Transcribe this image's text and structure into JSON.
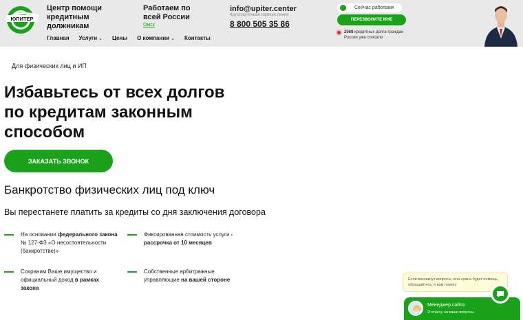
{
  "header": {
    "logo_text": "ЮПИТЕР",
    "brand_lines": [
      "Центр помощи",
      "кредитным",
      "должникам"
    ],
    "worktime_lines": [
      "Работаем по",
      "всей России"
    ],
    "city": "Омск",
    "nav": [
      {
        "label": "Главная",
        "dropdown": false
      },
      {
        "label": "Услуги",
        "dropdown": true
      },
      {
        "label": "Цены",
        "dropdown": false
      },
      {
        "label": "О компании",
        "dropdown": true
      },
      {
        "label": "Контакты",
        "dropdown": false
      }
    ],
    "email": "info@upiter.center",
    "hotline": "Круглосуточная горячая линия",
    "phone": "8 800 505 35 86",
    "status": "Сейчас работаем",
    "callback_btn": "ПЕРЕЗВОНИТЕ МНЕ",
    "debts_count": "2568",
    "debts_text": "кредитных долга граждан России уже списали"
  },
  "hero": {
    "tag": "Для физических лиц и ИП",
    "title_lines": [
      "Избавьтесь от всех долгов",
      "по кредитам законным",
      "способом"
    ],
    "order_btn": "ЗАКАЗАТЬ ЗВОНОК",
    "subtitle": "Банкротство физических лиц под ключ",
    "lead": "Вы перестанете платить за кредиты со дня заключения договора"
  },
  "features": [
    {
      "pre": "На основании ",
      "bold": "федерального закона",
      "post": " № 127-ФЗ «О несостоятельности (банкротстве)»"
    },
    {
      "pre": "Фиксированная стоимость услуги ",
      "bold": "- рассрочка от 10 месяцев",
      "post": ""
    },
    {
      "pre": "Сохраним Ваше имущество и официальный доход ",
      "bold": "в рамках закона",
      "post": ""
    },
    {
      "pre": "Собственные арбитражные управляющие ",
      "bold": "на вашей стороне",
      "post": ""
    }
  ],
  "chat": {
    "bubble": "Если возникнут вопросы, или нужна будет помощь, обращайтесь, я вам помогу",
    "name": "Менеджер сайта",
    "sub": "Я отвечу на ваши вопросы"
  },
  "colors": {
    "accent": "#1aa31a",
    "header_bg": "#e9e9e9",
    "alert": "#e03030"
  },
  "icons": [
    "logo-icon",
    "chevron-down-icon",
    "status-dot-icon",
    "chat-icon",
    "avatar"
  ]
}
